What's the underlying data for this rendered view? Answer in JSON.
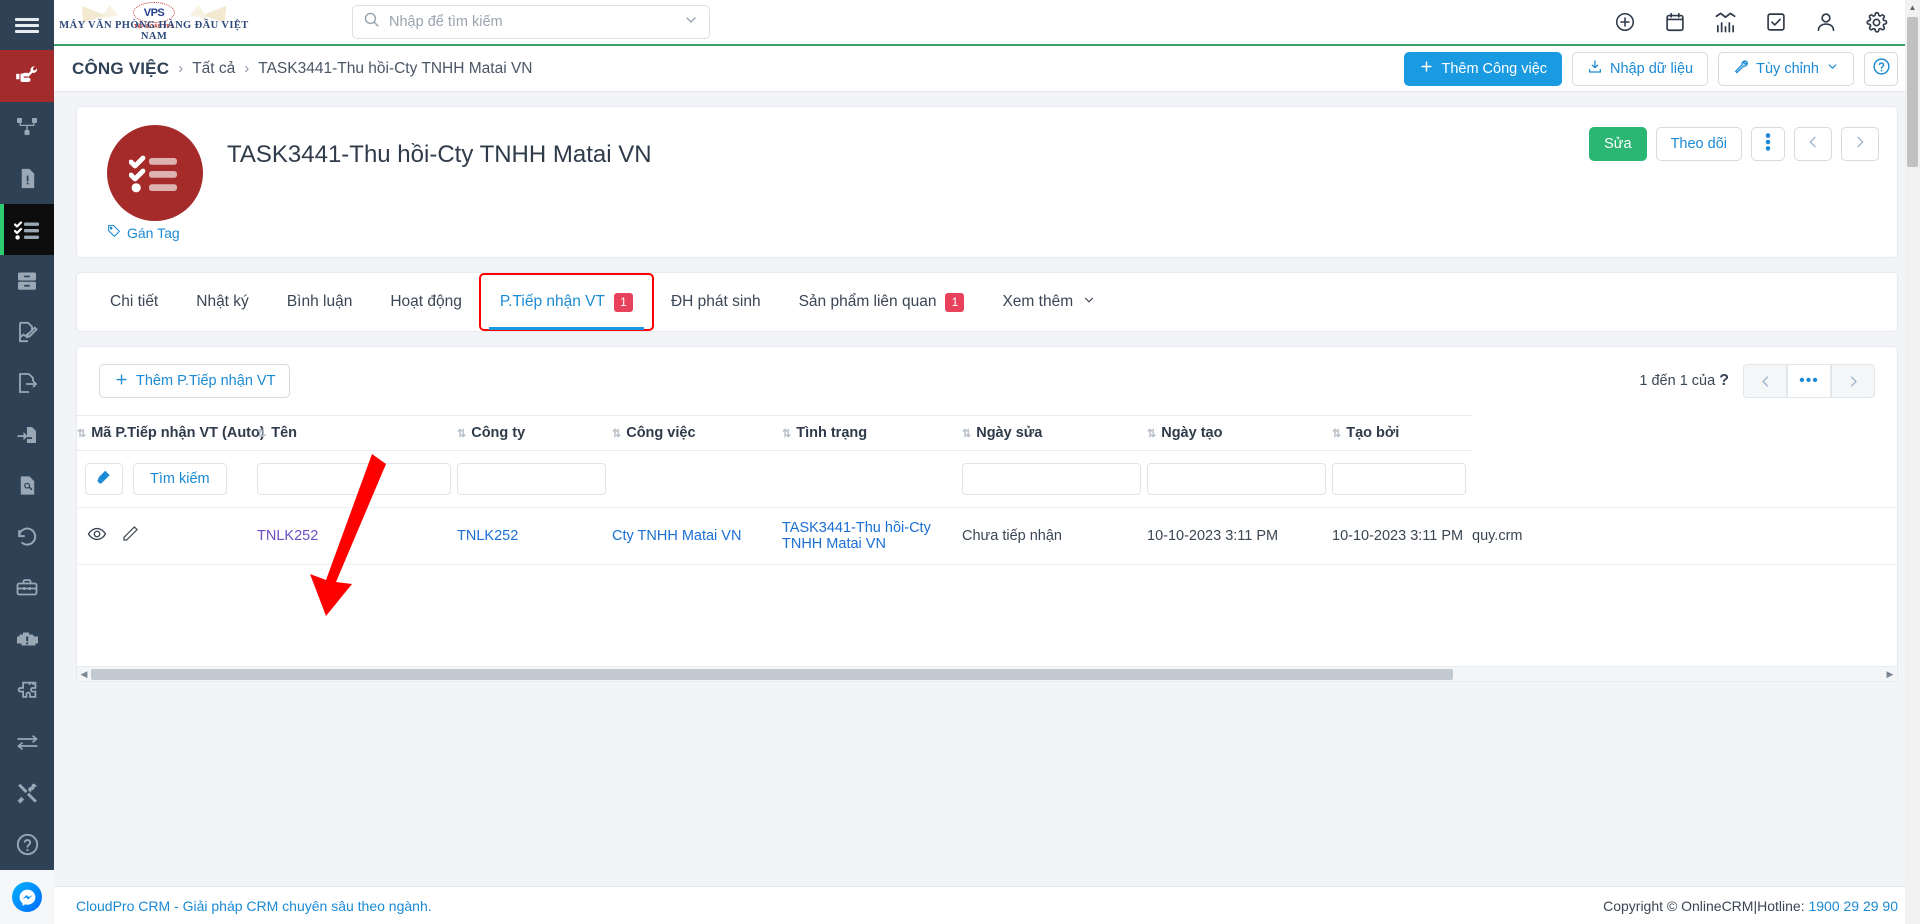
{
  "topbar": {
    "brand_text": "MÁY VĂN PHÒNG HÀNG ĐẦU VIỆT NAM",
    "brand_badge": "VPS",
    "brand_badge_sub": "TẬP ĐOÀN VPS",
    "search_placeholder": "Nhập để tìm kiếm",
    "search_value": "",
    "icons": [
      "plus-circle-icon",
      "calendar-icon",
      "chart-icon",
      "task-check-icon",
      "user-icon",
      "gear-icon"
    ]
  },
  "sidebar": {
    "burger": "menu-icon",
    "items": [
      {
        "name": "handshake-wrench-icon",
        "state": "active-red"
      },
      {
        "name": "sitemap-icon",
        "state": ""
      },
      {
        "name": "file-alert-icon",
        "state": ""
      },
      {
        "name": "checklist-icon",
        "state": "active-dark"
      },
      {
        "name": "archive-icon",
        "state": ""
      },
      {
        "name": "file-edit-icon",
        "state": ""
      },
      {
        "name": "file-export-icon",
        "state": ""
      },
      {
        "name": "file-import-icon",
        "state": ""
      },
      {
        "name": "file-search-icon",
        "state": ""
      },
      {
        "name": "history-icon",
        "state": ""
      },
      {
        "name": "toolbox-icon",
        "state": ""
      },
      {
        "name": "engine-warning-icon",
        "state": ""
      },
      {
        "name": "puzzle-icon",
        "state": ""
      },
      {
        "name": "exchange-icon",
        "state": ""
      },
      {
        "name": "tools-icon",
        "state": ""
      },
      {
        "name": "help-circle-icon",
        "state": ""
      }
    ],
    "messenger": "messenger-icon"
  },
  "breadcrumb": {
    "module": "CÔNG VIỆC",
    "separator": "›",
    "all": "Tất cả",
    "current": "TASK3441-Thu hồi-Cty TNHH Matai VN"
  },
  "crumb_actions": {
    "add_label": "Thêm Công việc",
    "import_label": "Nhập dữ liệu",
    "customize_label": "Tùy chỉnh",
    "help_label": "?"
  },
  "record": {
    "title": "TASK3441-Thu hồi-Cty TNHH Matai VN",
    "avatar_icon": "checklist-avatar-icon",
    "avatar_color": "#a52a2a",
    "tag_label": "Gán Tag",
    "edit_label": "Sửa",
    "follow_label": "Theo dõi",
    "more_label": "more-vertical-icon",
    "prev_label": "‹",
    "next_label": "›"
  },
  "tabs": [
    {
      "label": "Chi tiết",
      "badge": "",
      "active": false
    },
    {
      "label": "Nhật ký",
      "badge": "",
      "active": false
    },
    {
      "label": "Bình luận",
      "badge": "",
      "active": false
    },
    {
      "label": "Hoạt động",
      "badge": "",
      "active": false
    },
    {
      "label": "P.Tiếp nhận VT",
      "badge": "1",
      "active": true
    },
    {
      "label": "ĐH phát sinh",
      "badge": "",
      "active": false
    },
    {
      "label": "Sản phẩm liên quan",
      "badge": "1",
      "active": false
    },
    {
      "label": "Xem thêm",
      "badge": "",
      "active": false
    }
  ],
  "panel": {
    "add_button": "Thêm P.Tiếp nhận VT",
    "paging_text": "1 đến 1 của",
    "paging_unknown": "?",
    "pager_prev": "‹",
    "pager_dots": "•••",
    "pager_next": "›",
    "search_button": "Tìm kiếm",
    "eraser_icon": "eraser-icon",
    "columns": [
      "Mã P.Tiếp nhận VT (Auto)",
      "Tên",
      "Công ty",
      "Công việc",
      "Tình trạng",
      "Ngày sửa",
      "Ngày tạo",
      "Tạo bởi"
    ],
    "filters": [
      "",
      "",
      "",
      "",
      "",
      "",
      "",
      ""
    ],
    "rows": [
      {
        "view_icon": "eye-icon",
        "edit_icon": "pencil-icon",
        "ma": "TNLK252",
        "ten": "TNLK252",
        "cong_ty": "Cty TNHH Matai VN",
        "cong_viec": "TASK3441-Thu hồi-Cty TNHH Matai VN",
        "tinh_trang": "Chưa tiếp nhận",
        "ngay_sua": "10-10-2023 3:11 PM",
        "ngay_tao": "10-10-2023 3:11 PM",
        "tao_boi": "quy.crm"
      }
    ]
  },
  "footer": {
    "left": "CloudPro CRM - Giải pháp CRM chuyên sâu theo ngành.",
    "right_prefix": "Copyright © OnlineCRM",
    "right_sep": "|",
    "right_hotline_label": "Hotline:",
    "right_phone": "1900 29 29 90"
  },
  "annotations": {
    "arrow_color": "#ff0000",
    "highlight_color": "#ff0000"
  }
}
